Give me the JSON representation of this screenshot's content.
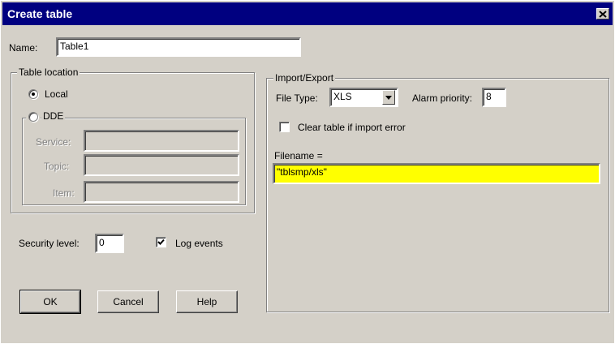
{
  "window": {
    "title": "Create table"
  },
  "name": {
    "label": "Name:",
    "value": "Table1"
  },
  "table_location": {
    "legend": "Table location",
    "local_label": "Local",
    "dde_label": "DDE",
    "selected": "Local",
    "service_label": "Service:",
    "topic_label": "Topic:",
    "item_label": "Item:"
  },
  "security": {
    "label": "Security level:",
    "value": "0"
  },
  "log_events": {
    "label": "Log events",
    "checked": true
  },
  "buttons": {
    "ok": "OK",
    "cancel": "Cancel",
    "help": "Help"
  },
  "import_export": {
    "legend": "Import/Export",
    "file_type_label": "File Type:",
    "file_type_value": "XLS",
    "alarm_priority_label": "Alarm priority:",
    "alarm_priority_value": "8",
    "clear_table_label": "Clear table if import error",
    "clear_table_checked": false,
    "filename_label": "Filename =",
    "filename_value": "\"tblsmp/xls\""
  },
  "icons": {
    "close": "close-icon",
    "dropdown": "chevron-down-icon"
  },
  "colors": {
    "titlebar": "#000080",
    "dialog_bg": "#d4d0c8",
    "filename_highlight": "#ffff00"
  }
}
